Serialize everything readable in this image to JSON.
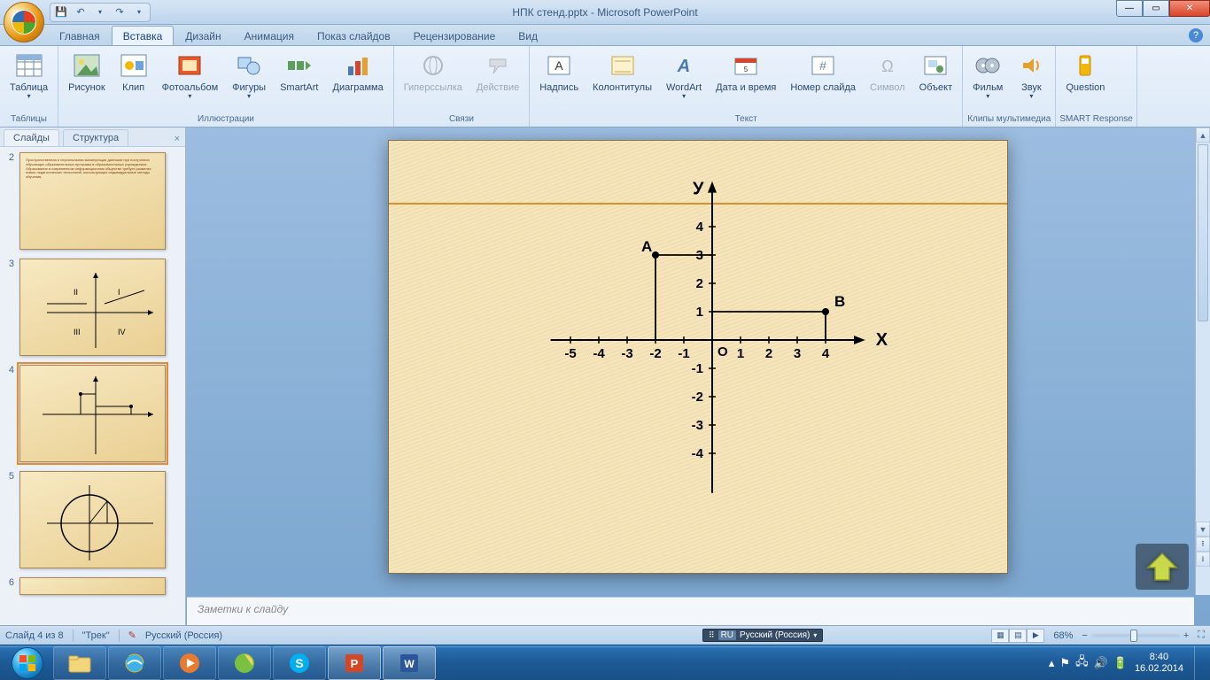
{
  "title": "НПК стенд.pptx - Microsoft PowerPoint",
  "qat": {
    "save": "💾",
    "undo": "↶",
    "redo": "↷",
    "dropdown": "▾"
  },
  "win": {
    "min": "—",
    "max": "▭",
    "close": "✕"
  },
  "tabs": {
    "home": "Главная",
    "insert": "Вставка",
    "design": "Дизайн",
    "anim": "Анимация",
    "show": "Показ слайдов",
    "review": "Рецензирование",
    "view": "Вид"
  },
  "ribbon": {
    "tables": {
      "table": "Таблица",
      "group": "Таблицы"
    },
    "illus": {
      "image": "Рисунок",
      "clip": "Клип",
      "album": "Фотоальбом",
      "shapes": "Фигуры",
      "smartart": "SmartArt",
      "chart": "Диаграмма",
      "group": "Иллюстрации"
    },
    "links": {
      "hyperlink": "Гиперссылка",
      "action": "Действие",
      "group": "Связи"
    },
    "text": {
      "textbox": "Надпись",
      "headerfooter": "Колонтитулы",
      "wordart": "WordArt",
      "datetime": "Дата и время",
      "slidenum": "Номер слайда",
      "symbol": "Символ",
      "object": "Объект",
      "group": "Текст"
    },
    "media": {
      "movie": "Фильм",
      "sound": "Звук",
      "group": "Клипы мультимедиа"
    },
    "smart": {
      "question": "Question",
      "group": "SMART Response"
    }
  },
  "pane": {
    "slides": "Слайды",
    "outline": "Структура",
    "close": "×"
  },
  "thumbs": {
    "n2": "2",
    "n3": "3",
    "n4": "4",
    "n5": "5",
    "n6": "6"
  },
  "notes": "Заметки к слайду",
  "status": {
    "slide": "Слайд 4 из 8",
    "theme": "\"Трек\"",
    "lang": "Русский (Россия)",
    "langbadge_ru": "RU",
    "langbadge_full": "Русский (Россия)",
    "zoom": "68%"
  },
  "tray": {
    "time": "8:40",
    "date": "16.02.2014"
  },
  "chart_data": {
    "type": "scatter",
    "title": "",
    "xlabel": "X",
    "ylabel": "У",
    "origin_label": "O",
    "xlim": [
      -5,
      4
    ],
    "ylim": [
      -4,
      4
    ],
    "xticks": [
      -5,
      -4,
      -3,
      -2,
      -1,
      1,
      2,
      3,
      4
    ],
    "yticks": [
      -4,
      -3,
      -2,
      -1,
      1,
      2,
      3,
      4
    ],
    "points": [
      {
        "name": "A",
        "x": -2,
        "y": 3
      },
      {
        "name": "B",
        "x": 4,
        "y": 1
      }
    ],
    "segments": [
      {
        "from": {
          "x": -2,
          "y": 3
        },
        "to": {
          "x": -2,
          "y": 0
        }
      },
      {
        "from": {
          "x": -2,
          "y": 3
        },
        "to": {
          "x": 0,
          "y": 3
        }
      },
      {
        "from": {
          "x": 0,
          "y": 1
        },
        "to": {
          "x": 4,
          "y": 1
        }
      },
      {
        "from": {
          "x": 4,
          "y": 1
        },
        "to": {
          "x": 4,
          "y": 0
        }
      }
    ]
  }
}
